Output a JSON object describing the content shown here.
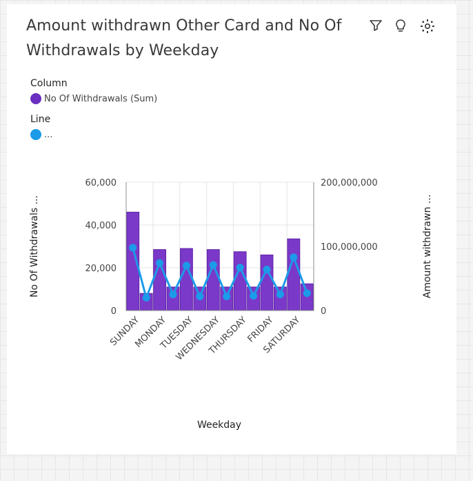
{
  "card": {
    "title": "Amount withdrawn Other Card and No Of Withdrawals by Weekday",
    "toolbar": {
      "filter_icon": "filter-icon",
      "insight_icon": "lightbulb-icon",
      "settings_icon": "gear-icon"
    }
  },
  "legend": {
    "column_title": "Column",
    "column_series": "No Of Withdrawals (Sum)",
    "line_title": "Line",
    "line_series": "..."
  },
  "colors": {
    "bar": "#7b39c9",
    "bar_stroke": "#5e23a5",
    "line": "#1b9be8",
    "grid": "#e4e4e4"
  },
  "chart_data": {
    "type": "bar",
    "categories": [
      "SUNDAY",
      "MONDAY",
      "TUESDAY",
      "WEDNESDAY",
      "THURSDAY",
      "FRIDAY",
      "SATURDAY"
    ],
    "xlabel": "Weekday",
    "ylabel": "No Of Withdrawals ...",
    "y2label": "Amount withdrawn ...",
    "ylim": [
      0,
      60000
    ],
    "y2lim": [
      0,
      200000000
    ],
    "yticks": [
      "0",
      "20,000",
      "40,000",
      "60,000"
    ],
    "y2ticks": [
      "0",
      "100,000,000",
      "200,000,000"
    ],
    "grid": true,
    "series": [
      {
        "name": "No Of Withdrawals (Sum)",
        "type": "bar",
        "axis": "left",
        "values": [
          46000,
          8000,
          28500,
          11000,
          29000,
          11000,
          28500,
          11000,
          27500,
          11000,
          26000,
          11000,
          33500,
          12500
        ]
      },
      {
        "name": "...",
        "type": "line",
        "axis": "right",
        "values": [
          98000000,
          20000000,
          74000000,
          25000000,
          70000000,
          22000000,
          71000000,
          22000000,
          67000000,
          23000000,
          64000000,
          25000000,
          83000000,
          27000000
        ]
      }
    ]
  }
}
